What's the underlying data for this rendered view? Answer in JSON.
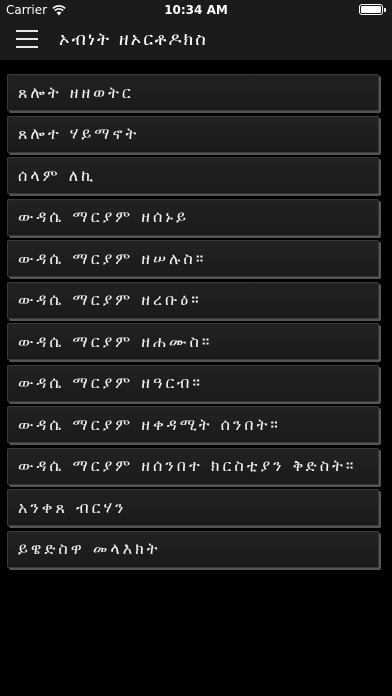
{
  "status_bar": {
    "carrier": "Carrier",
    "time": "10:34 AM"
  },
  "nav": {
    "title": "ኦብነት ዘኦርቶዶክስ",
    "menu_icon": "hamburger-menu-icon"
  },
  "items": [
    {
      "label": "ጸሎት ዘዘወትር"
    },
    {
      "label": "ጸሎተ ሃይማኖት"
    },
    {
      "label": "ሰላም ለኪ"
    },
    {
      "label": "ውዳሴ ማርያም ዘሰኑይ"
    },
    {
      "label": "ውዳሴ ማርያም ዘሠሉስ።"
    },
    {
      "label": "ውዳሴ ማርያም ዘረቡዕ።"
    },
    {
      "label": "ውዳሴ ማርያም ዘሐሙስ።"
    },
    {
      "label": "ውዳሴ ማርያም ዘዓርብ።"
    },
    {
      "label": "ውዳሴ ማርያም ዘቀዳሚት ሰንበት።"
    },
    {
      "label": "ውዳሴ ማርያም ዘሰንበተ ክርስቲያን ቅድስት።"
    },
    {
      "label": "አንቀጸ ብርሃን"
    },
    {
      "label": "ይዌድስዋ መላእክት"
    }
  ]
}
